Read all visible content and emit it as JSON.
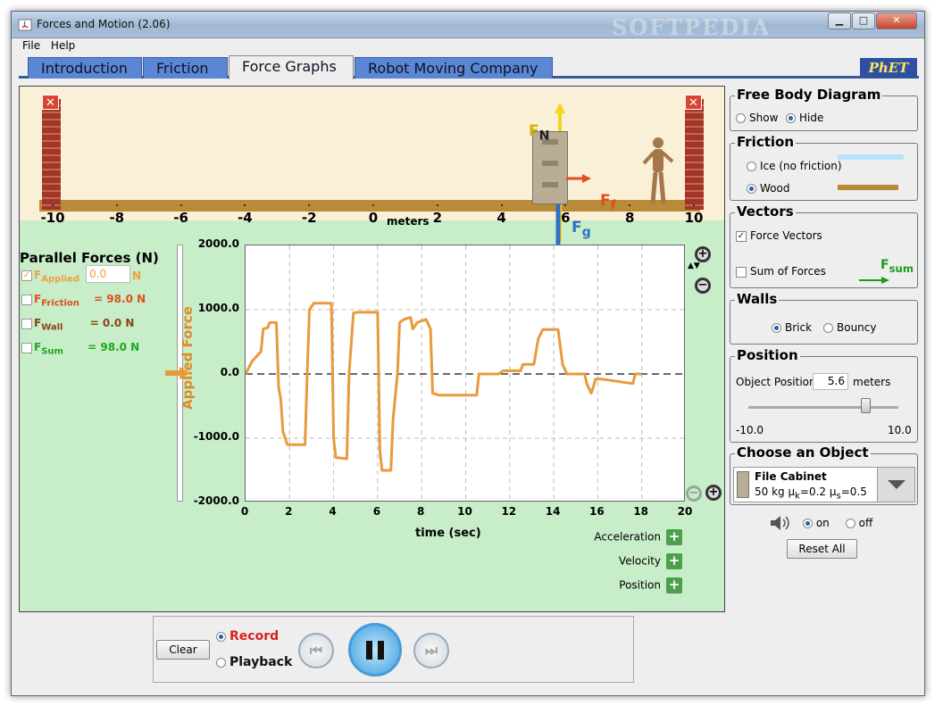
{
  "window": {
    "title": "Forces and Motion (2.06)",
    "watermark": "SOFTPEDIA"
  },
  "menu": [
    "File",
    "Help"
  ],
  "tabs": [
    {
      "label": "Introduction",
      "active": false
    },
    {
      "label": "Friction",
      "active": false
    },
    {
      "label": "Force Graphs",
      "active": true
    },
    {
      "label": "Robot Moving Company",
      "active": false
    }
  ],
  "logo": "PhET",
  "scene": {
    "ticks": [
      "-10",
      "-8",
      "-6",
      "-4",
      "-2",
      "0",
      "2",
      "4",
      "6",
      "8",
      "10"
    ],
    "units": "meters",
    "force_labels": {
      "normal": "F",
      "normal_sub": "N",
      "friction": "F",
      "friction_sub": "f",
      "gravity": "F",
      "gravity_sub": "g"
    }
  },
  "parallel_forces": {
    "title": "Parallel Forces (N)",
    "applied": {
      "label": "F",
      "sub": "Applied",
      "value": "0.0",
      "unit": "N",
      "checked": true,
      "color": "#f0a040"
    },
    "friction": {
      "label": "F",
      "sub": "Friction",
      "value": "= 98.0 N",
      "checked": false,
      "color": "#e0501c"
    },
    "wall": {
      "label": "F",
      "sub": "Wall",
      "value": "= 0.0 N",
      "checked": false,
      "color": "#8b4513"
    },
    "sum": {
      "label": "F",
      "sub": "Sum",
      "value": "= 98.0 N",
      "checked": false,
      "color": "#1caa1c"
    }
  },
  "graph": {
    "y_axis_label": "Applied Force",
    "x_axis_label": "time (sec)",
    "y_ticks": [
      "2000.0",
      "1000.0",
      "0.0",
      "-1000.0",
      "-2000.0"
    ],
    "x_ticks": [
      "0",
      "2",
      "4",
      "6",
      "8",
      "10",
      "12",
      "14",
      "16",
      "18",
      "20"
    ],
    "add_graphs": [
      "Acceleration",
      "Velocity",
      "Position"
    ]
  },
  "chart_data": {
    "type": "line",
    "x_unit": "time (sec)",
    "xlim": [
      0,
      20
    ],
    "ylim": [
      -2000,
      2000
    ],
    "series": [
      {
        "color": "#e89a3c",
        "points": [
          [
            0,
            0
          ],
          [
            0.3,
            200
          ],
          [
            0.7,
            350
          ],
          [
            0.8,
            700
          ],
          [
            1.0,
            720
          ],
          [
            1.1,
            800
          ],
          [
            1.4,
            800
          ],
          [
            1.5,
            -200
          ],
          [
            1.6,
            -400
          ],
          [
            1.7,
            -900
          ],
          [
            1.9,
            -1100
          ],
          [
            2.7,
            -1100
          ],
          [
            2.8,
            0
          ],
          [
            2.9,
            1000
          ],
          [
            3.1,
            1100
          ],
          [
            3.9,
            1100
          ],
          [
            4.0,
            -1000
          ],
          [
            4.1,
            -1300
          ],
          [
            4.6,
            -1320
          ],
          [
            4.7,
            0
          ],
          [
            4.9,
            950
          ],
          [
            5.1,
            960
          ],
          [
            6.0,
            960
          ],
          [
            6.1,
            -1200
          ],
          [
            6.2,
            -1500
          ],
          [
            6.6,
            -1500
          ],
          [
            6.7,
            -700
          ],
          [
            6.9,
            0
          ],
          [
            7.0,
            800
          ],
          [
            7.2,
            850
          ],
          [
            7.5,
            880
          ],
          [
            7.6,
            700
          ],
          [
            7.8,
            800
          ],
          [
            8.2,
            850
          ],
          [
            8.4,
            700
          ],
          [
            8.5,
            -300
          ],
          [
            8.8,
            -330
          ],
          [
            10.5,
            -330
          ],
          [
            10.6,
            0
          ],
          [
            11.5,
            0
          ],
          [
            11.7,
            50
          ],
          [
            12.5,
            50
          ],
          [
            12.6,
            150
          ],
          [
            13.1,
            150
          ],
          [
            13.3,
            550
          ],
          [
            13.5,
            690
          ],
          [
            14.2,
            690
          ],
          [
            14.4,
            150
          ],
          [
            14.6,
            0
          ],
          [
            15.4,
            0
          ],
          [
            15.5,
            -150
          ],
          [
            15.7,
            -300
          ],
          [
            15.8,
            -200
          ],
          [
            15.9,
            -80
          ],
          [
            16.2,
            -80
          ],
          [
            17.6,
            -150
          ],
          [
            17.7,
            0
          ],
          [
            18.0,
            0
          ]
        ]
      }
    ]
  },
  "free_body": {
    "title": "Free Body Diagram",
    "show": "Show",
    "hide": "Hide",
    "selected": "Hide"
  },
  "friction": {
    "title": "Friction",
    "ice": "Ice (no friction)",
    "wood": "Wood",
    "selected": "Wood"
  },
  "vectors": {
    "title": "Vectors",
    "force_vectors": "Force Vectors",
    "force_checked": true,
    "sum_of_forces": "Sum of Forces",
    "sum_checked": false,
    "sum_label": "F",
    "sum_sub": "sum"
  },
  "walls": {
    "title": "Walls",
    "brick": "Brick",
    "bouncy": "Bouncy",
    "selected": "Brick"
  },
  "position": {
    "title": "Position",
    "label": "Object Position",
    "value": "5.6",
    "unit": "meters",
    "min": "-10.0",
    "max": "10.0",
    "slider_value": 5.6
  },
  "object": {
    "title": "Choose an Object",
    "name": "File Cabinet",
    "mass": "50 kg",
    "uk_sym": "μ",
    "uk_sub": "k",
    "uk_val": "=0.2",
    "us_sym": "μ",
    "us_sub": "s",
    "us_val": "=0.5"
  },
  "sound": {
    "on": "on",
    "off": "off",
    "selected": "on"
  },
  "reset": "Reset All",
  "recorder": {
    "clear": "Clear",
    "record": "Record",
    "playback": "Playback",
    "selected": "Record"
  }
}
